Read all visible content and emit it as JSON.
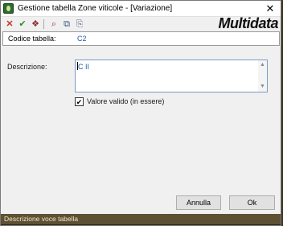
{
  "window": {
    "title": "Gestione tabella Zone viticole - [Variazione]",
    "close_symbol": "✕"
  },
  "toolbar": {
    "icons": [
      "delete-x-icon",
      "confirm-check-icon",
      "book-icon",
      "search-binoculars-icon",
      "copy-icon",
      "paste-icon"
    ],
    "glyphs": [
      "✕",
      "✔",
      "❖",
      "⌕",
      "⧉",
      "⎘"
    ]
  },
  "logo": {
    "text": "Multidata"
  },
  "code": {
    "label": "Codice tabella:",
    "value": "C2"
  },
  "description": {
    "label": "Descrizione:",
    "value": "C II",
    "scroll_up": "▲",
    "scroll_down": "▼"
  },
  "valid": {
    "label": "Valore valido (in essere)",
    "checked": true,
    "mark": "✔"
  },
  "buttons": {
    "cancel": "Annulla",
    "ok": "Ok"
  },
  "status": {
    "text": "Descrizione voce tabella"
  },
  "colors": {
    "value_text": "#1f5ea8",
    "status_bar": "#5e5033"
  }
}
